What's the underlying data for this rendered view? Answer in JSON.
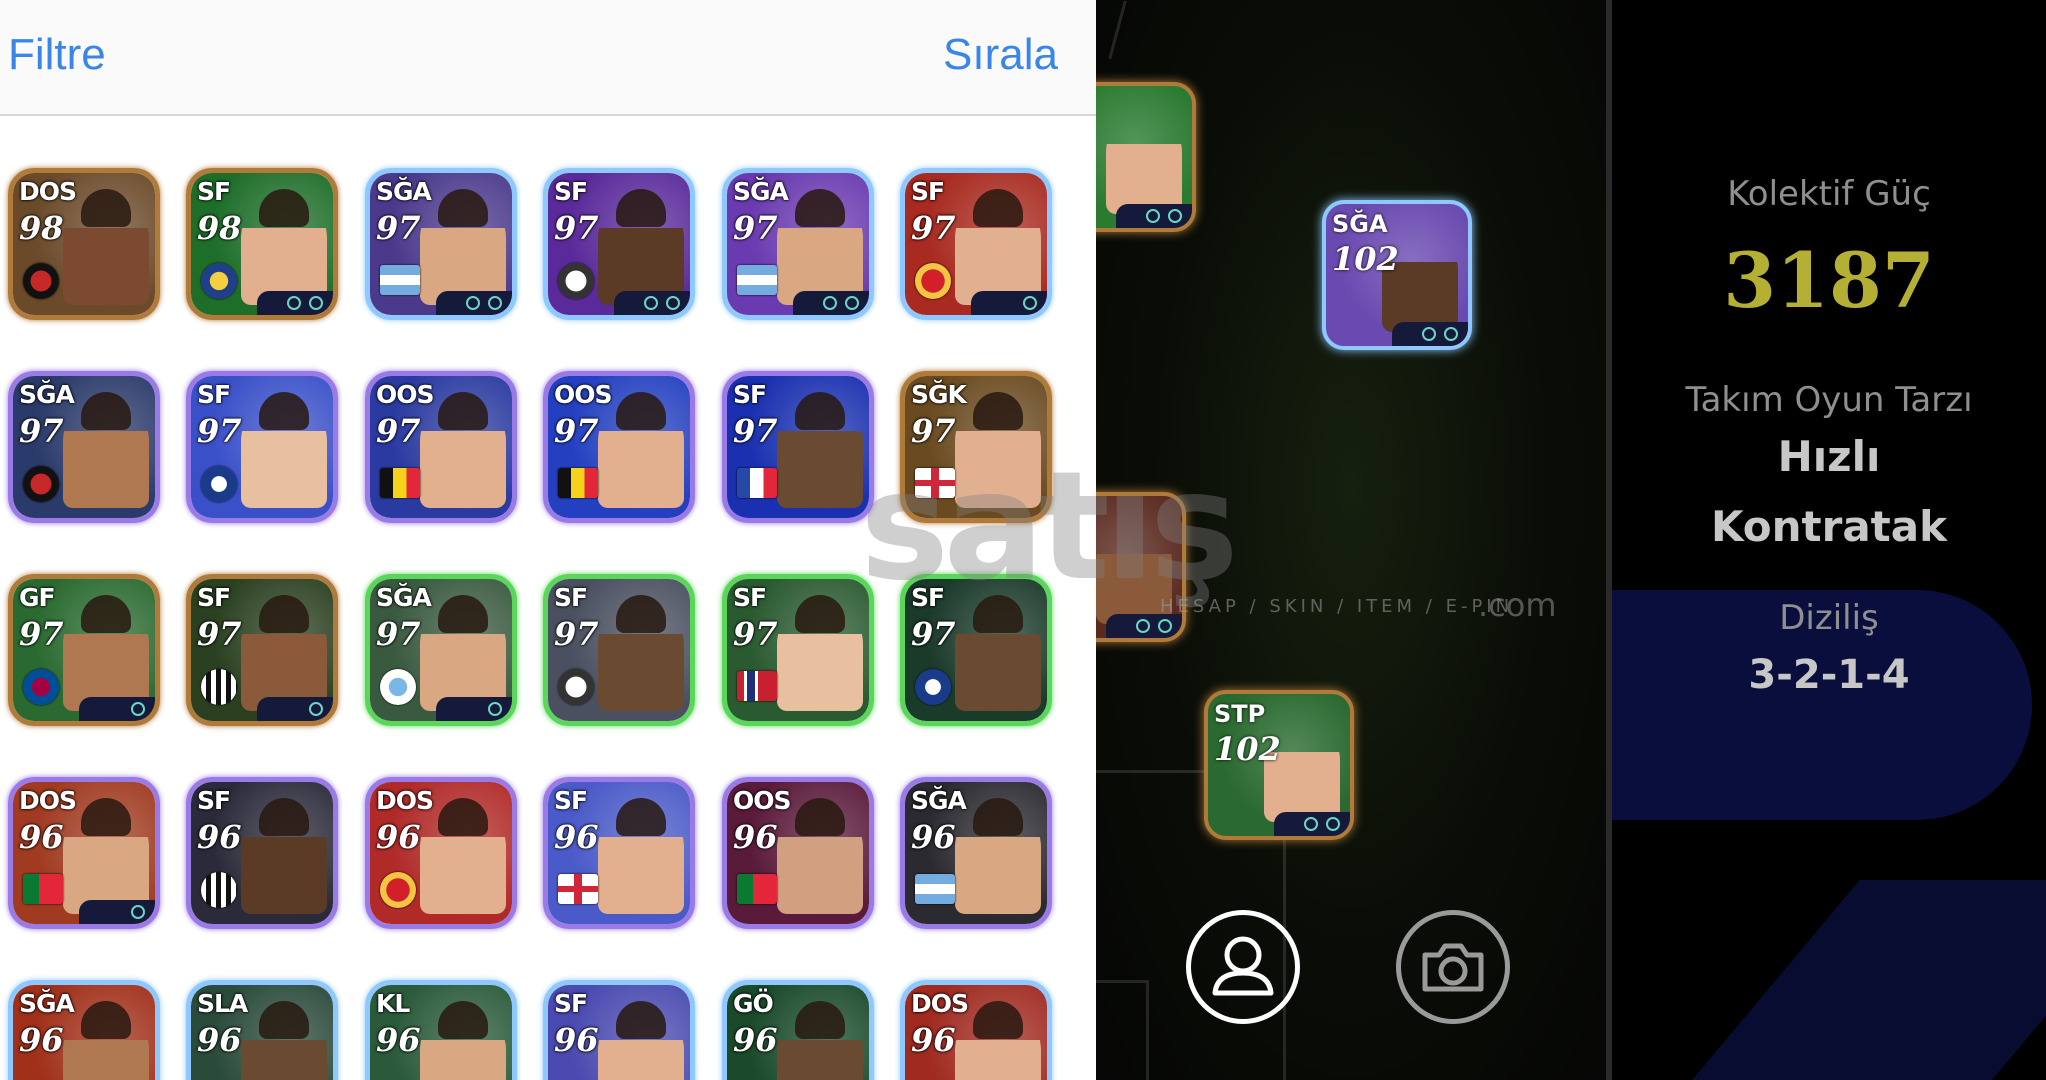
{
  "header": {
    "filter_label": "Filtre",
    "sort_label": "Sırala"
  },
  "cards": [
    {
      "pos": "DOS",
      "rating": "98",
      "border": "#b07a3a",
      "bg": "#6b4a2a",
      "skin": "#7b4a30",
      "badge": "fr-club1",
      "round": true,
      "tray": 0
    },
    {
      "pos": "SF",
      "rating": "98",
      "border": "#b07a3a",
      "bg": "#1e6e2a",
      "skin": "#e3b08f",
      "badge": "fr-club2",
      "round": true,
      "tray": 2
    },
    {
      "pos": "SĞA",
      "rating": "97",
      "border": "#8ec8ff",
      "bg": "#4b3a8c",
      "skin": "#d9a882",
      "badge": "fr-ar",
      "round": false,
      "tray": 2
    },
    {
      "pos": "SF",
      "rating": "97",
      "border": "#8ec8ff",
      "bg": "#5a2a9a",
      "skin": "#5b3a26",
      "badge": "fr-club3",
      "round": true,
      "tray": 2
    },
    {
      "pos": "SĞA",
      "rating": "97",
      "border": "#8ec8ff",
      "bg": "#6a3ab0",
      "skin": "#d9a882",
      "badge": "fr-ar",
      "round": false,
      "tray": 2
    },
    {
      "pos": "SF",
      "rating": "97",
      "border": "#8ec8ff",
      "bg": "#a82a20",
      "skin": "#e0b090",
      "badge": "fr-club5",
      "round": true,
      "tray": 1
    },
    {
      "pos": "SĞA",
      "rating": "97",
      "border": "#9a7ae6",
      "bg": "#2a3a6a",
      "skin": "#b07850",
      "badge": "fr-club1",
      "round": true,
      "tray": 0
    },
    {
      "pos": "SF",
      "rating": "97",
      "border": "#9a7ae6",
      "bg": "#3a50c8",
      "skin": "#e8c0a0",
      "badge": "fr-club4",
      "round": true,
      "tray": 0
    },
    {
      "pos": "OOS",
      "rating": "97",
      "border": "#9a7ae6",
      "bg": "#2a3aa0",
      "skin": "#e3b08f",
      "badge": "fr-be",
      "round": false,
      "tray": 0
    },
    {
      "pos": "OOS",
      "rating": "97",
      "border": "#9a7ae6",
      "bg": "#2440c0",
      "skin": "#e3b08f",
      "badge": "fr-be",
      "round": false,
      "tray": 0
    },
    {
      "pos": "SF",
      "rating": "97",
      "border": "#9a7ae6",
      "bg": "#1a30b0",
      "skin": "#6a4a30",
      "badge": "fr-fr",
      "round": false,
      "tray": 0
    },
    {
      "pos": "SĞK",
      "rating": "97",
      "border": "#b07a3a",
      "bg": "#6a4a20",
      "skin": "#e0b090",
      "badge": "fr-en",
      "round": false,
      "tray": 0
    },
    {
      "pos": "GF",
      "rating": "97",
      "border": "#b07a3a",
      "bg": "#2a6a30",
      "skin": "#b07850",
      "badge": "fr-club7",
      "round": true,
      "tray": 1
    },
    {
      "pos": "SF",
      "rating": "97",
      "border": "#b07a3a",
      "bg": "#2a4020",
      "skin": "#8a5a3a",
      "badge": "fr-club8",
      "round": true,
      "tray": 1
    },
    {
      "pos": "SĞA",
      "rating": "97",
      "border": "#5ad65a",
      "bg": "#3a5a40",
      "skin": "#d9a882",
      "badge": "fr-club6",
      "round": true,
      "tray": 1
    },
    {
      "pos": "SF",
      "rating": "97",
      "border": "#5ad65a",
      "bg": "#4a5060",
      "skin": "#6a4a30",
      "badge": "fr-club3",
      "round": true,
      "tray": 0
    },
    {
      "pos": "SF",
      "rating": "97",
      "border": "#5ad65a",
      "bg": "#2a5a30",
      "skin": "#e8c0a0",
      "badge": "fr-no",
      "round": false,
      "tray": 0
    },
    {
      "pos": "SF",
      "rating": "97",
      "border": "#5ad65a",
      "bg": "#1a3a2a",
      "skin": "#6a4a30",
      "badge": "fr-club4",
      "round": true,
      "tray": 0
    },
    {
      "pos": "DOS",
      "rating": "96",
      "border": "#9a7ae6",
      "bg": "#a03a20",
      "skin": "#d9a882",
      "badge": "fr-pt",
      "round": false,
      "tray": 1
    },
    {
      "pos": "SF",
      "rating": "96",
      "border": "#9a7ae6",
      "bg": "#2a2a3a",
      "skin": "#5b3a26",
      "badge": "fr-club8",
      "round": true,
      "tray": 0
    },
    {
      "pos": "DOS",
      "rating": "96",
      "border": "#9a7ae6",
      "bg": "#b02a28",
      "skin": "#e3b08f",
      "badge": "fr-club5",
      "round": true,
      "tray": 0
    },
    {
      "pos": "SF",
      "rating": "96",
      "border": "#9a7ae6",
      "bg": "#4a5ac8",
      "skin": "#e3b08f",
      "badge": "fr-en",
      "round": false,
      "tray": 0
    },
    {
      "pos": "OOS",
      "rating": "96",
      "border": "#9a7ae6",
      "bg": "#5a1a3a",
      "skin": "#d0a080",
      "badge": "fr-pt",
      "round": false,
      "tray": 0
    },
    {
      "pos": "SĞA",
      "rating": "96",
      "border": "#9a7ae6",
      "bg": "#2a2a30",
      "skin": "#d9a882",
      "badge": "fr-ar",
      "round": false,
      "tray": 0
    },
    {
      "pos": "SĞA",
      "rating": "96",
      "border": "#8ec8ff",
      "bg": "#a0301a",
      "skin": "#b07850",
      "badge": "fr-club5",
      "round": true,
      "tray": 0
    },
    {
      "pos": "SLA",
      "rating": "96",
      "border": "#8ec8ff",
      "bg": "#2a4a3a",
      "skin": "#6a4a30",
      "badge": "fr-club3",
      "round": true,
      "tray": 0
    },
    {
      "pos": "KL",
      "rating": "96",
      "border": "#8ec8ff",
      "bg": "#2a5a3a",
      "skin": "#d9a882",
      "badge": "fr-club3",
      "round": true,
      "tray": 0
    },
    {
      "pos": "SF",
      "rating": "96",
      "border": "#8ec8ff",
      "bg": "#4a4ab0",
      "skin": "#e3b08f",
      "badge": "fr-en",
      "round": false,
      "tray": 0
    },
    {
      "pos": "GÖ",
      "rating": "96",
      "border": "#8ec8ff",
      "bg": "#1a4a2a",
      "skin": "#6a4a30",
      "badge": "fr-fr",
      "round": false,
      "tray": 0
    },
    {
      "pos": "DOS",
      "rating": "96",
      "border": "#8ec8ff",
      "bg": "#a02a20",
      "skin": "#e0b090",
      "badge": "fr-club5",
      "round": true,
      "tray": 0
    }
  ],
  "pitch_cards": [
    {
      "pos": "",
      "rating": "",
      "border": "#b07a3a",
      "bg": "#2a7a30",
      "skin": "#e3b08f"
    },
    {
      "pos": "SĞA",
      "rating": "102",
      "border": "#8ec8ff",
      "bg": "#6a4ab0",
      "skin": "#5b3a26"
    },
    {
      "pos": "",
      "rating": "",
      "border": "#b07a3a",
      "bg": "#5a2a20",
      "skin": "#8a5a3a"
    },
    {
      "pos": "STP",
      "rating": "102",
      "border": "#b07a3a",
      "bg": "#2a6a30",
      "skin": "#e3b08f"
    }
  ],
  "stats": {
    "power_label": "Kolektif Güç",
    "power_value": "3187",
    "style_label": "Takım Oyun Tarzı",
    "style_value_1": "Hızlı",
    "style_value_2": "Kontratak",
    "formation_label": "Diziliş",
    "formation_value": "3-2-1-4"
  },
  "watermark": {
    "text": "satış",
    "sub": "HESAP / SKIN / ITEM / E-PIN",
    "com": ".com"
  },
  "icons": {
    "profile": "person-icon",
    "camera": "camera-icon"
  }
}
